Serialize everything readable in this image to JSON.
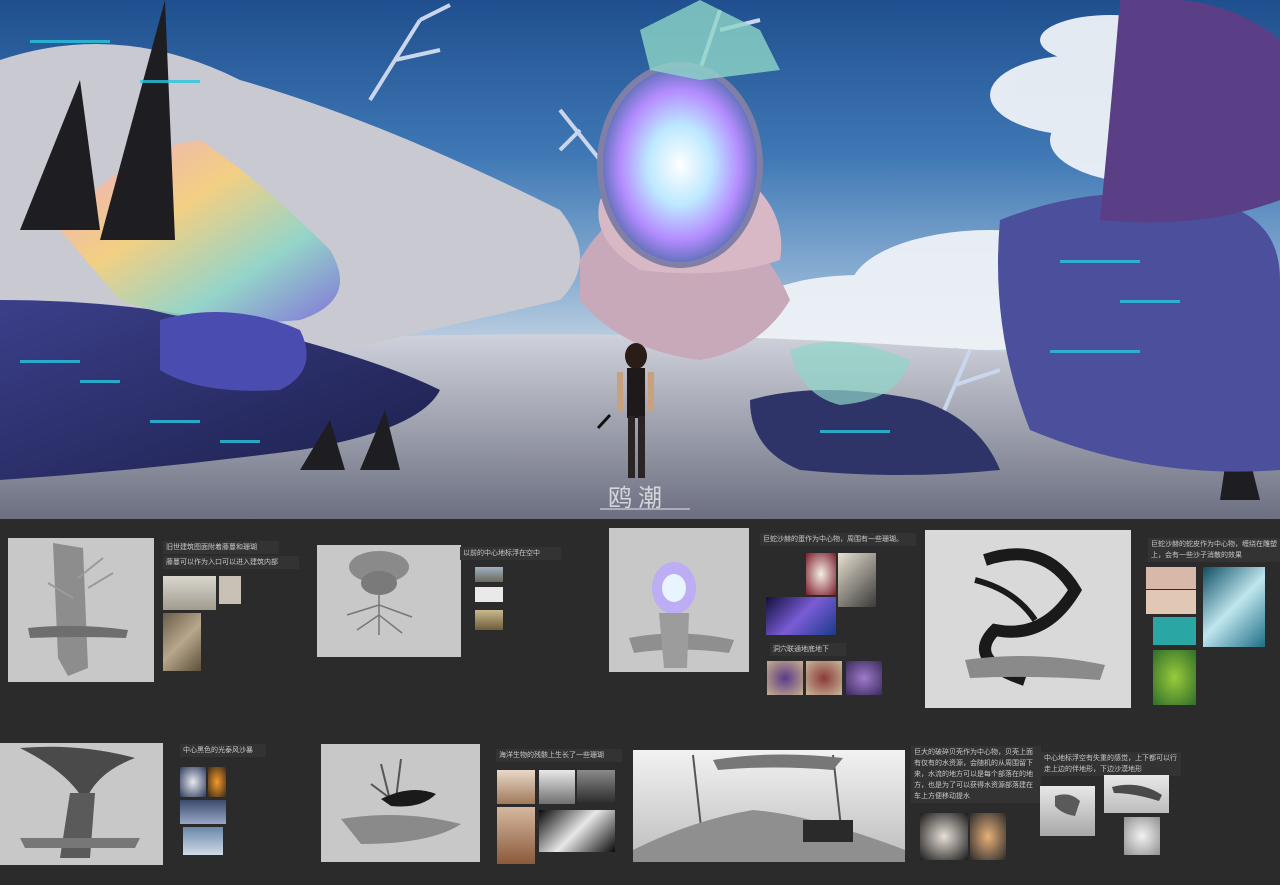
{
  "hero": {
    "logo_text": "鸥潮",
    "colors": {
      "sky": "#2f66a8",
      "cloud": "#e9eef4",
      "crystal": "#b9a8ff",
      "rock": "#2c2a5e",
      "glow": "#29c6e0"
    }
  },
  "row1": {
    "panel1": {
      "label_a": "旧世建筑图面附着藤蔓和珊瑚",
      "label_b": "藤蔓可以作为入口可以进入建筑内部"
    },
    "panel2": {
      "label": "以前的中心地标浮在空中"
    },
    "panel3": {
      "label_a": "巨蛇沙赫的蛋作为中心物，周围有一些珊瑚。",
      "label_b": "洞穴联通地底地下"
    },
    "panel4": {
      "label": "巨蛇沙赫的蛇皮作为中心物，缠绕在雕塑上，会有一些沙子消散的效果"
    }
  },
  "row2": {
    "panel5": {
      "label": "中心黑色的光泰风沙暴"
    },
    "panel6": {
      "label": "海洋生物的残骸上生长了一些珊瑚"
    },
    "panel7": {
      "label": "巨大的破碎贝壳作为中心物，贝壳上面有仅有的水资源，会随机的从周围留下来，水流的地方可以是每个部落在的地方，也是为了可以获得水资源部落建在车上方便移动提水"
    },
    "panel8": {
      "label": "中心地标浮空有失重的感觉，上下都可以行走上边的伴地形，下边沙漠地形"
    }
  }
}
